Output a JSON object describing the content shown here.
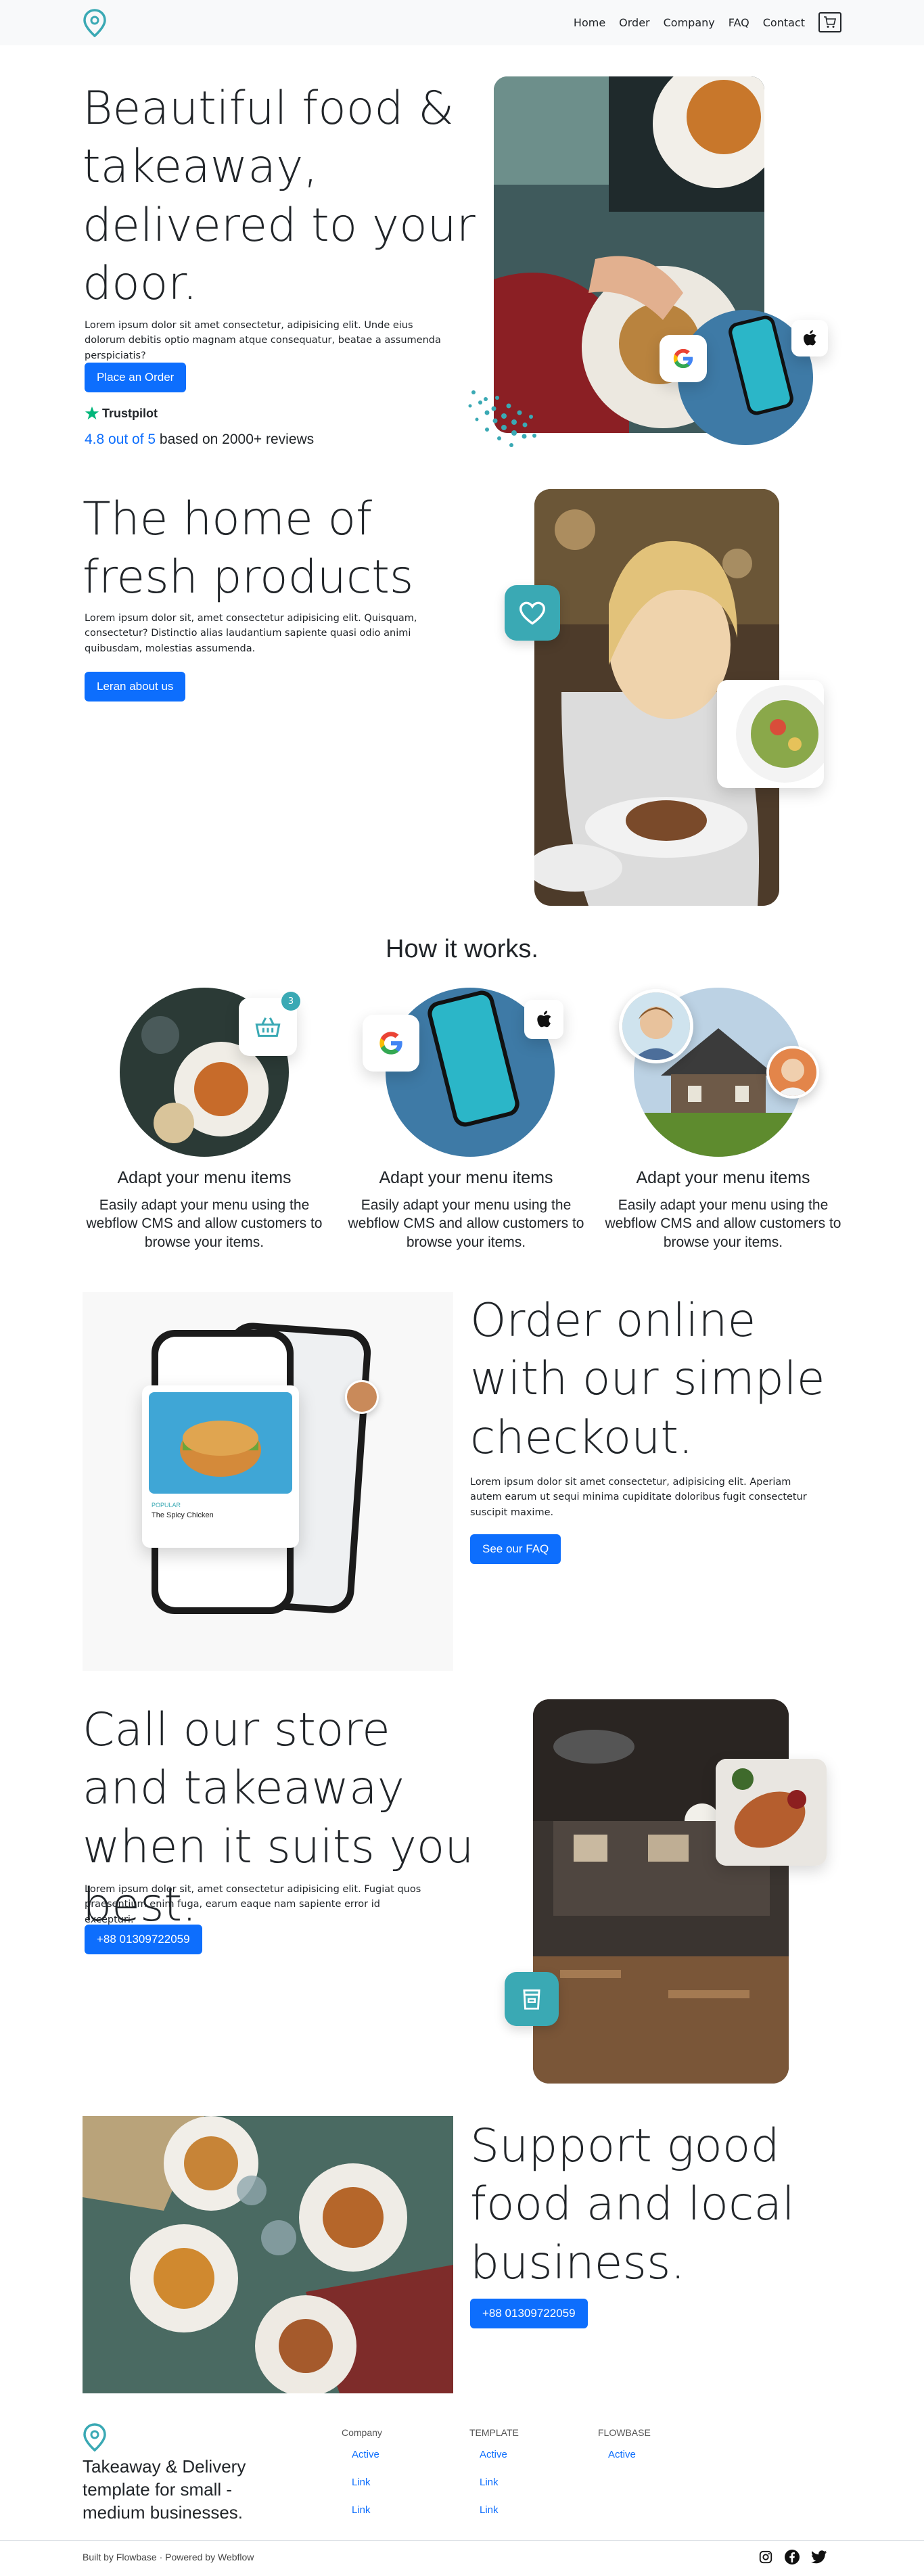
{
  "nav": {
    "items": [
      "Home",
      "Order",
      "Company",
      "FAQ",
      "Contact"
    ],
    "logo_icon": "location-pin-icon",
    "cart_icon": "shopping-cart-icon"
  },
  "hero": {
    "title": "Beautiful food & takeaway, delivered to your door.",
    "text": "Lorem ipsum dolor sit amet consectetur, adipisicing elit. Unde eius dolorum debitis optio magnam atque consequatur, beatae a assumenda perspiciatis?",
    "button": "Place an Order",
    "trustpilot": "Trustpilot",
    "rating_highlight": "4.8 out of 5",
    "rating_rest": " based on 2000+ reviews"
  },
  "fresh": {
    "title": "The home of fresh products",
    "text": "Lorem ipsum dolor sit, amet consectetur adipisicing elit. Quisquam, consectetur? Distinctio alias laudantium sapiente quasi odio animi quibusdam, molestias assumenda.",
    "button": "Leran about us"
  },
  "how": {
    "title": "How it works.",
    "steps": [
      {
        "title": "Adapt your menu items",
        "text": "Easily adapt your menu using the webflow CMS and allow customers to browse your items."
      },
      {
        "title": "Adapt your menu items",
        "text": "Easily adapt your menu using the webflow CMS and allow customers to browse your items."
      },
      {
        "title": "Adapt your menu items",
        "text": "Easily adapt your menu using the webflow CMS and allow customers to browse your items."
      }
    ],
    "basket_count": "3"
  },
  "order": {
    "title": "Order online with our simple checkout.",
    "text": "Lorem ipsum dolor sit amet consectetur, adipisicing elit. Aperiam autem earum ut sequi minima cupiditate doloribus fugit consectetur suscipit maxime.",
    "button": "See our FAQ",
    "phone_card_label": "POPULAR",
    "phone_card_title": "The Spicy Chicken"
  },
  "call": {
    "title": "Call our store and takeaway when it suits you best.",
    "text": "Lorem ipsum dolor sit, amet consectetur adipisicing elit. Fugiat quos praesentium enim fuga, earum eaque nam sapiente error id excepturi.",
    "button": "+88 01309722059"
  },
  "support": {
    "title": "Support good food and local business.",
    "button": "+88 01309722059"
  },
  "footer": {
    "tagline": "Takeaway & Delivery template for small - medium businesses.",
    "columns": [
      {
        "head": "Company",
        "links": [
          "Active",
          "Link",
          "Link"
        ]
      },
      {
        "head": "TEMPLATE",
        "links": [
          "Active",
          "Link",
          "Link"
        ]
      },
      {
        "head": "FLOWBASE",
        "links": [
          "Active"
        ]
      }
    ],
    "credit": "Built by Flowbase · Powered by Webflow"
  },
  "colors": {
    "primary": "#0d6efd",
    "teal": "#3aa9b4",
    "nav_bg": "#f8f9fa"
  }
}
